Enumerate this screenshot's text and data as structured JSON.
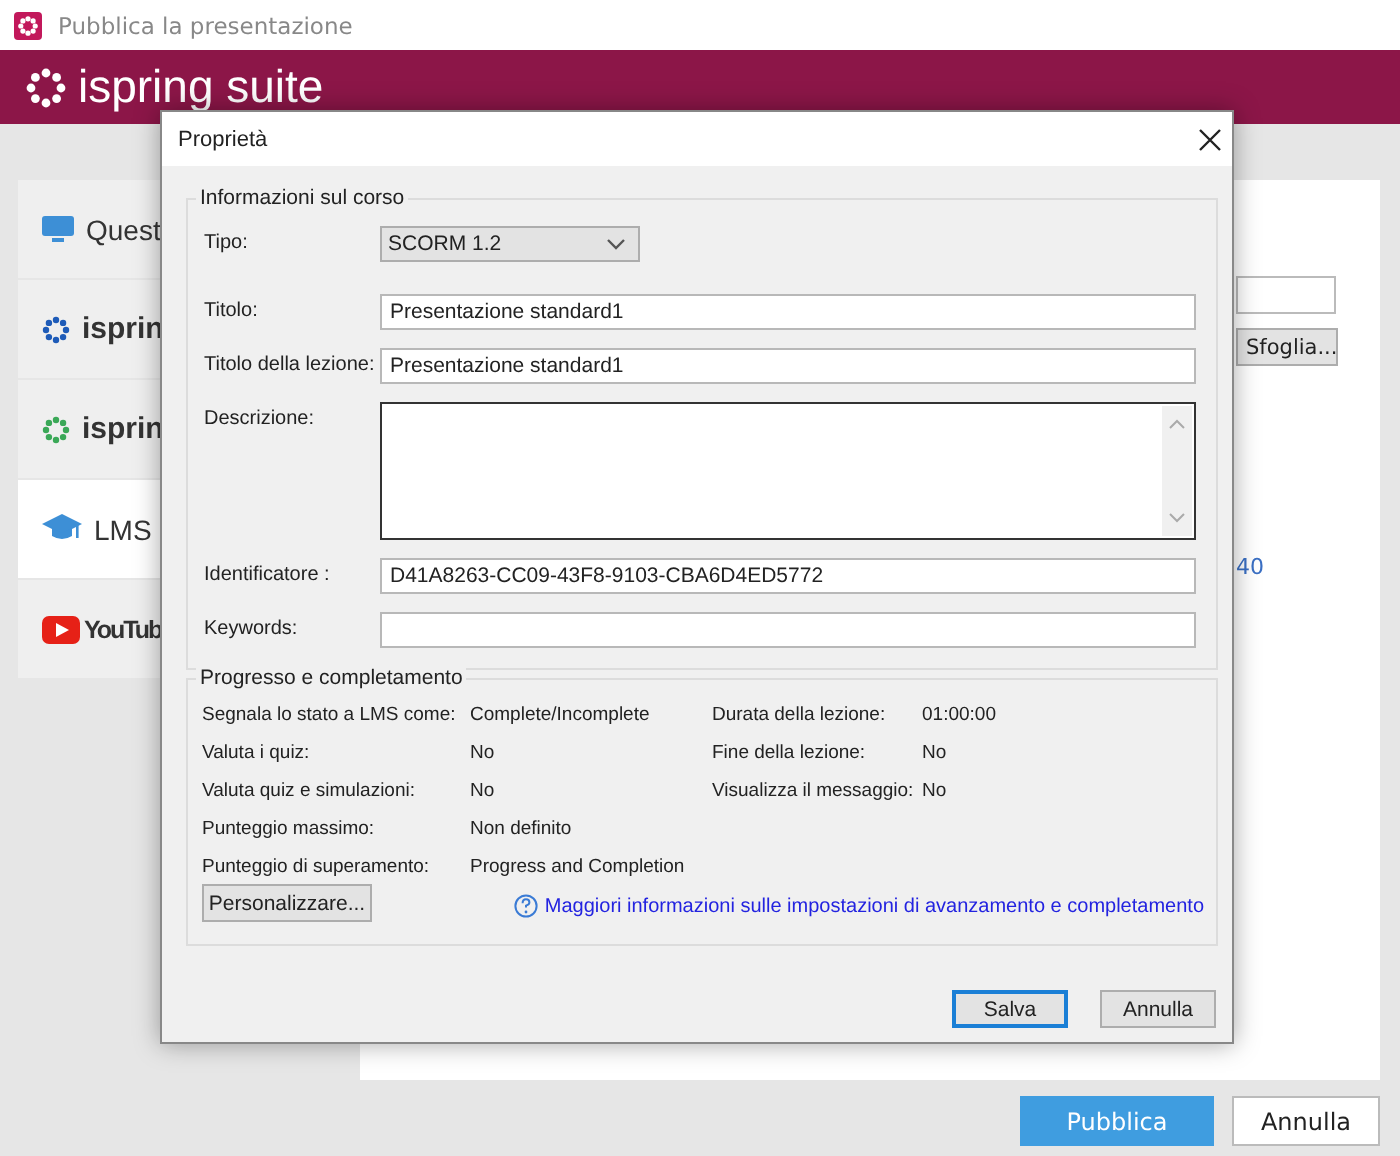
{
  "window": {
    "title": "Pubblica la presentazione"
  },
  "header": {
    "logo": "ispring suite"
  },
  "sidebar": {
    "items": [
      {
        "label": "Quest",
        "kind": "monitor",
        "selected": false
      },
      {
        "label": "isprin",
        "kind": "sparkblue",
        "selected": false
      },
      {
        "label": "isprin",
        "kind": "sparkgreen",
        "selected": false
      },
      {
        "label": "LMS",
        "kind": "cap",
        "selected": true
      },
      {
        "label": "YouTub",
        "kind": "youtube",
        "selected": false
      }
    ]
  },
  "main": {
    "browse_button": "Sfoglia...",
    "link_fragment": "40"
  },
  "footer": {
    "buttons": [
      {
        "label": "Pubblica",
        "kind": "primary"
      },
      {
        "label": "Annulla",
        "kind": "plain"
      }
    ]
  },
  "dialog": {
    "title": "Proprietà",
    "course_info": {
      "legend": "Informazioni sul corso",
      "fields": [
        {
          "label": "Tipo:",
          "kind": "select",
          "value": "SCORM 1.2"
        },
        {
          "label": "Titolo:",
          "kind": "text",
          "value": "Presentazione standard1"
        },
        {
          "label": "Titolo della lezione:",
          "kind": "text",
          "value": "Presentazione standard1"
        },
        {
          "label": "Descrizione:",
          "kind": "textarea"
        },
        {
          "label": "Identificatore :",
          "kind": "text",
          "value": "D41A8263-CC09-43F8-9103-CBA6D4ED5772"
        },
        {
          "label": "Keywords:",
          "kind": "text"
        }
      ]
    },
    "progress": {
      "legend": "Progresso e completamento",
      "rows": [
        {
          "label": "Segnala lo stato a LMS come:",
          "value": "Complete/Incomplete",
          "label_2": "Durata della lezione:",
          "value_2": "01:00:00"
        },
        {
          "label": "Valuta  i quiz:",
          "value": "No",
          "label_2": "Fine della lezione:",
          "value_2": "No"
        },
        {
          "label": "Valuta quiz e simulazioni:",
          "value": "No",
          "label_2": "Visualizza il  messaggio:",
          "value_2": "No"
        },
        {
          "label": "Punteggio massimo:",
          "value": "Non definito"
        },
        {
          "label": "Punteggio di superamento:",
          "value": "Progress and Completion"
        }
      ],
      "customize_button": "Personalizzare...",
      "help_link": "Maggiori informazioni sulle impostazioni di avanzamento e completamento"
    },
    "buttons": [
      {
        "label": "Salva",
        "focused": true
      },
      {
        "label": "Annulla",
        "focused": false
      }
    ]
  }
}
